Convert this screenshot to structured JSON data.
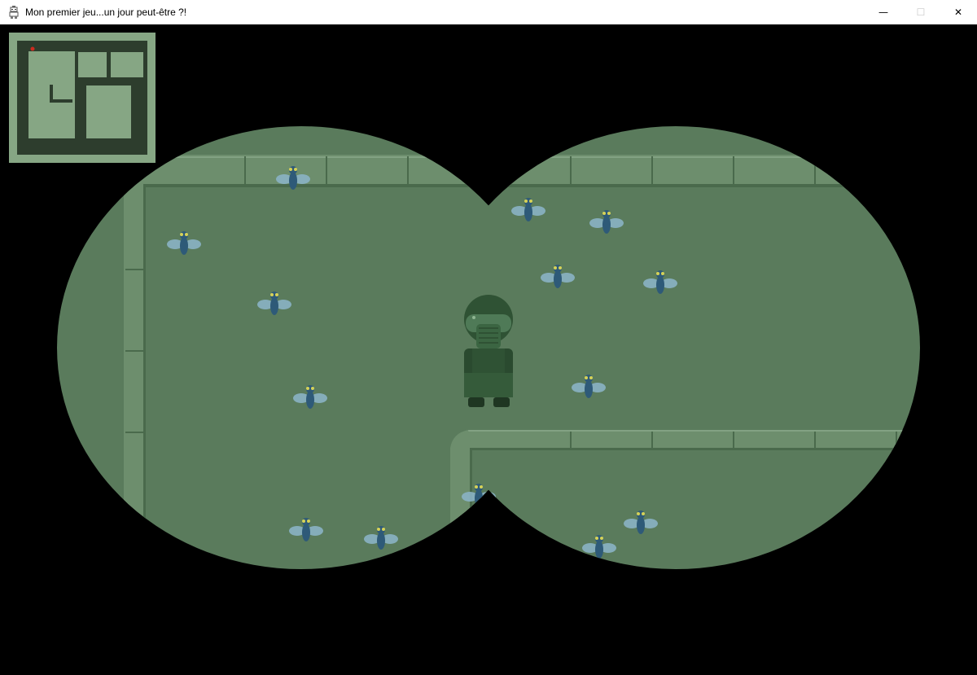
{
  "window": {
    "title": "Mon premier jeu...un jour peut-être ?!",
    "icon": "robot-app-icon",
    "controls": {
      "minimize_icon": "minimize-icon",
      "maximize_icon": "maximize-icon",
      "close_icon": "close-icon",
      "minimize_glyph": "—",
      "maximize_glyph": "☐",
      "close_glyph": "✕"
    }
  },
  "game": {
    "view_mode": "binoculars",
    "palette": {
      "background": "#000000",
      "floor": "#5a7b5c",
      "wall_top": "#6d8e6d",
      "wall_edge": "#4a6a4c",
      "player": "#2f5234",
      "fly_body": "#2e5a78",
      "fly_wing": "#8ab3c4",
      "fly_eye": "#d6d257",
      "minimap_frame": "#86a684",
      "minimap_bg": "#2d3d2d",
      "minimap_room": "#86a684",
      "minimap_player_dot": "#cc2b1f"
    },
    "player": {
      "sprite": "gas-mask-soldier",
      "facing": "down"
    },
    "enemies": {
      "type": "fly",
      "visible_count": 15
    },
    "minimap": {
      "player_marker": "red-dot"
    }
  }
}
